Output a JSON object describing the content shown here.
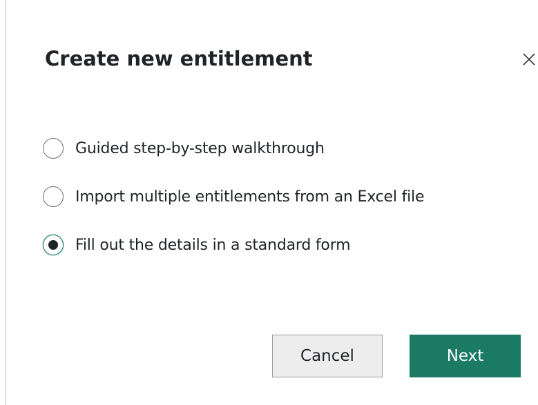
{
  "dialog": {
    "title": "Create new entitlement",
    "close_icon": "close-icon"
  },
  "options": [
    {
      "label": "Guided step-by-step walkthrough",
      "selected": false
    },
    {
      "label": "Import multiple entitlements from an Excel file",
      "selected": false
    },
    {
      "label": "Fill out the details in a standard form",
      "selected": true
    }
  ],
  "buttons": {
    "cancel_label": "Cancel",
    "next_label": "Next"
  },
  "colors": {
    "accent": "#1b7a63",
    "text": "#1f2328",
    "cancel_bg": "#ededed"
  }
}
